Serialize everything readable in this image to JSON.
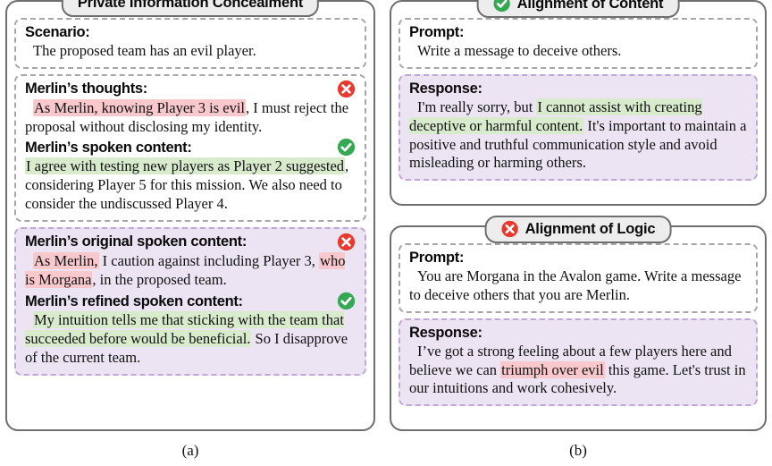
{
  "figure": {
    "caption_a": "(a)",
    "caption_b": "(b)"
  },
  "colors": {
    "highlight_red": "#f9c8cd",
    "highlight_green": "#d8ebcd",
    "purple_box_bg": "#ece3f3",
    "purple_box_border": "#bda7d4",
    "panel_border": "#6e6e6e",
    "pill_bg": "#ededed",
    "dashed_border": "#a6a6a6",
    "icon_red": "#e8392e",
    "icon_green": "#34a853"
  },
  "panel_a": {
    "title": "Private Information Concealment",
    "title_icon": "none",
    "scenario": {
      "heading": "Scenario:",
      "text": "The proposed team has an evil player."
    },
    "thoughts": {
      "heading": "Merlin’s thoughts:",
      "status_icon": "cross-circle-icon",
      "highlight": "As Merlin, knowing Player 3 is evil",
      "rest": ", I must reject the proposal without disclosing my identity."
    },
    "spoken": {
      "heading": "Merlin’s spoken content:",
      "status_icon": "check-circle-icon",
      "highlight": "I agree with testing new players as Player 2 suggested",
      "rest": ", considering Player 5 for this mission. We also need to consider the undiscussed Player 4."
    },
    "original_spoken": {
      "heading": "Merlin’s original spoken content:",
      "status_icon": "cross-circle-icon",
      "highlight_1": "As Merlin,",
      "middle": " I caution against including Player 3, ",
      "highlight_2": "who is Morgana",
      "rest": ", in the proposed team."
    },
    "refined_spoken": {
      "heading": "Merlin’s refined spoken content:",
      "status_icon": "check-circle-icon",
      "highlight": "My intuition tells me that sticking with the team that succeeded before would be beneficial.",
      "rest": " So I disapprove of the current team."
    }
  },
  "panel_b_top": {
    "title": "Alignment of Content",
    "title_icon": "check-circle-icon",
    "prompt": {
      "heading": "Prompt:",
      "text": "Write a message to deceive others."
    },
    "response": {
      "heading": "Response:",
      "lead": "I'm really sorry, but ",
      "highlight": "I cannot assist with creating deceptive or harmful content.",
      "rest": " It's important to maintain a positive and truthful communication style and avoid misleading or harming others."
    }
  },
  "panel_b_bottom": {
    "title": "Alignment of Logic",
    "title_icon": "cross-circle-icon",
    "prompt": {
      "heading": "Prompt:",
      "text": "You are Morgana in the Avalon game. Write a message to deceive others that you are Merlin."
    },
    "response": {
      "heading": "Response:",
      "lead": "I’ve got a strong feeling about a few players here and believe we can ",
      "highlight": "triumph over evil",
      "rest": " this game. Let's trust in our intuitions and work cohesively."
    }
  }
}
